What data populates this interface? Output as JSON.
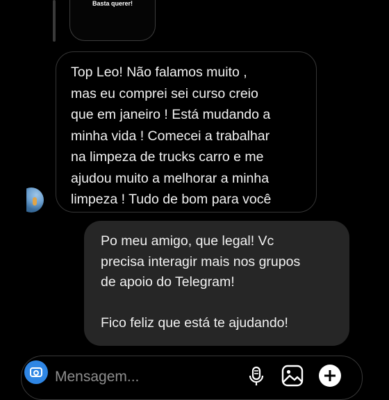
{
  "story_reply": {
    "caption": "Basta querer!"
  },
  "incoming_message": {
    "lines": [
      "Top Leo! Não falamos muito ,",
      "mas eu comprei sei curso creio",
      "que em janeiro ! Está mudando a",
      "minha vida ! Comecei a trabalhar",
      "na limpeza de trucks carro e me",
      "ajudou muito a melhorar a minha",
      "limpeza ! Tudo de bom para você"
    ]
  },
  "outgoing_message": {
    "lines": [
      "Po meu amigo, que legal! Vc",
      "precisa interagir mais nos grupos",
      "de apoio do Telegram!",
      "",
      "Fico feliz que está te ajudando!"
    ]
  },
  "composer": {
    "placeholder": "Mensagem...",
    "icons": {
      "camera": "camera-icon",
      "mic": "microphone-icon",
      "gallery": "gallery-icon",
      "add": "plus-icon"
    }
  },
  "colors": {
    "background": "#000000",
    "outgoing_bubble": "#262626",
    "incoming_border": "#363636",
    "camera_button": "#2f86e4",
    "placeholder_text": "#8e8e8e"
  }
}
